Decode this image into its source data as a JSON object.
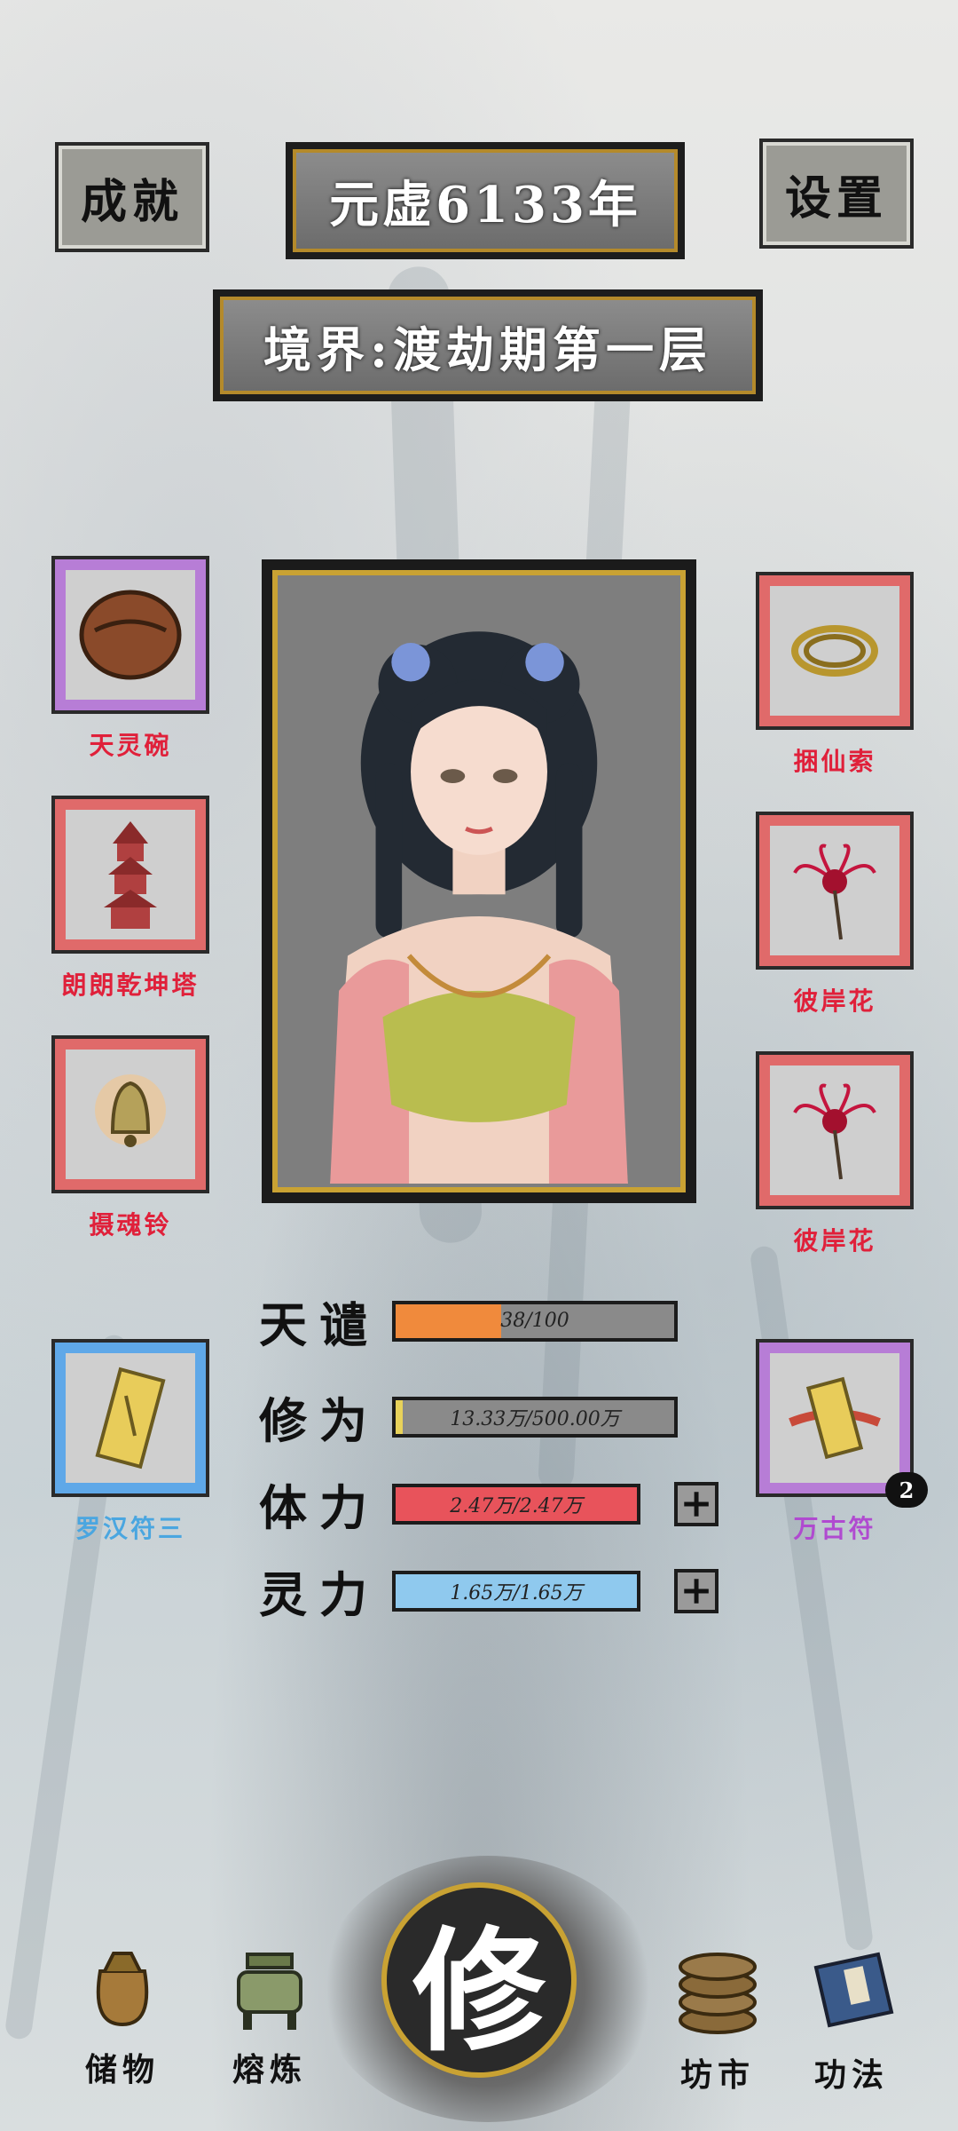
{
  "header": {
    "achievement_label": "成就",
    "year_label": "元虚6133年",
    "settings_label": "设置"
  },
  "realm": {
    "label": "境界:渡劫期第一层"
  },
  "left_items": [
    {
      "name": "天灵碗",
      "icon": "bowl-icon",
      "color": "#e0203a",
      "frame": "#b77dd6"
    },
    {
      "name": "朗朗乾坤塔",
      "icon": "pagoda-icon",
      "color": "#e0203a",
      "frame": "#e06a6a"
    },
    {
      "name": "摄魂铃",
      "icon": "bell-icon",
      "color": "#e0203a",
      "frame": "#e06a6a"
    },
    {
      "name": "罗汉符三",
      "icon": "talisman-icon",
      "color": "#4aa6e0",
      "frame": "#5fa8e8"
    }
  ],
  "right_items": [
    {
      "name": "捆仙索",
      "icon": "rope-icon",
      "color": "#e0203a",
      "frame": "#e06a6a"
    },
    {
      "name": "彼岸花",
      "icon": "spider-lily-icon",
      "color": "#e0203a",
      "frame": "#e06a6a"
    },
    {
      "name": "彼岸花",
      "icon": "spider-lily-icon",
      "color": "#e0203a",
      "frame": "#e06a6a"
    },
    {
      "name": "万古符",
      "icon": "scroll-talisman-icon",
      "color": "#b04ad0",
      "frame": "#b77dd6",
      "badge": "2"
    }
  ],
  "stats": [
    {
      "label": "天谴",
      "text": "38/100",
      "fraction": 0.38,
      "color": "#f08a3c",
      "plus": false
    },
    {
      "label": "修为",
      "text": "13.33万/500.00万",
      "fraction": 0.027,
      "color": "#e8d25a",
      "plus": false
    },
    {
      "label": "体力",
      "text": "2.47万/2.47万",
      "fraction": 1.0,
      "color": "#e8535b",
      "plus": true
    },
    {
      "label": "灵力",
      "text": "1.65万/1.65万",
      "fraction": 1.0,
      "color": "#8fc9ee",
      "plus": true
    }
  ],
  "nav": {
    "storage": {
      "label": "储物",
      "icon": "pouch-icon"
    },
    "smelting": {
      "label": "熔炼",
      "icon": "cauldron-icon"
    },
    "cultivate": {
      "label": "修",
      "icon": "cultivate-emblem"
    },
    "market": {
      "label": "坊市",
      "icon": "coins-icon"
    },
    "skills": {
      "label": "功法",
      "icon": "book-icon"
    }
  },
  "plus_label": "+"
}
